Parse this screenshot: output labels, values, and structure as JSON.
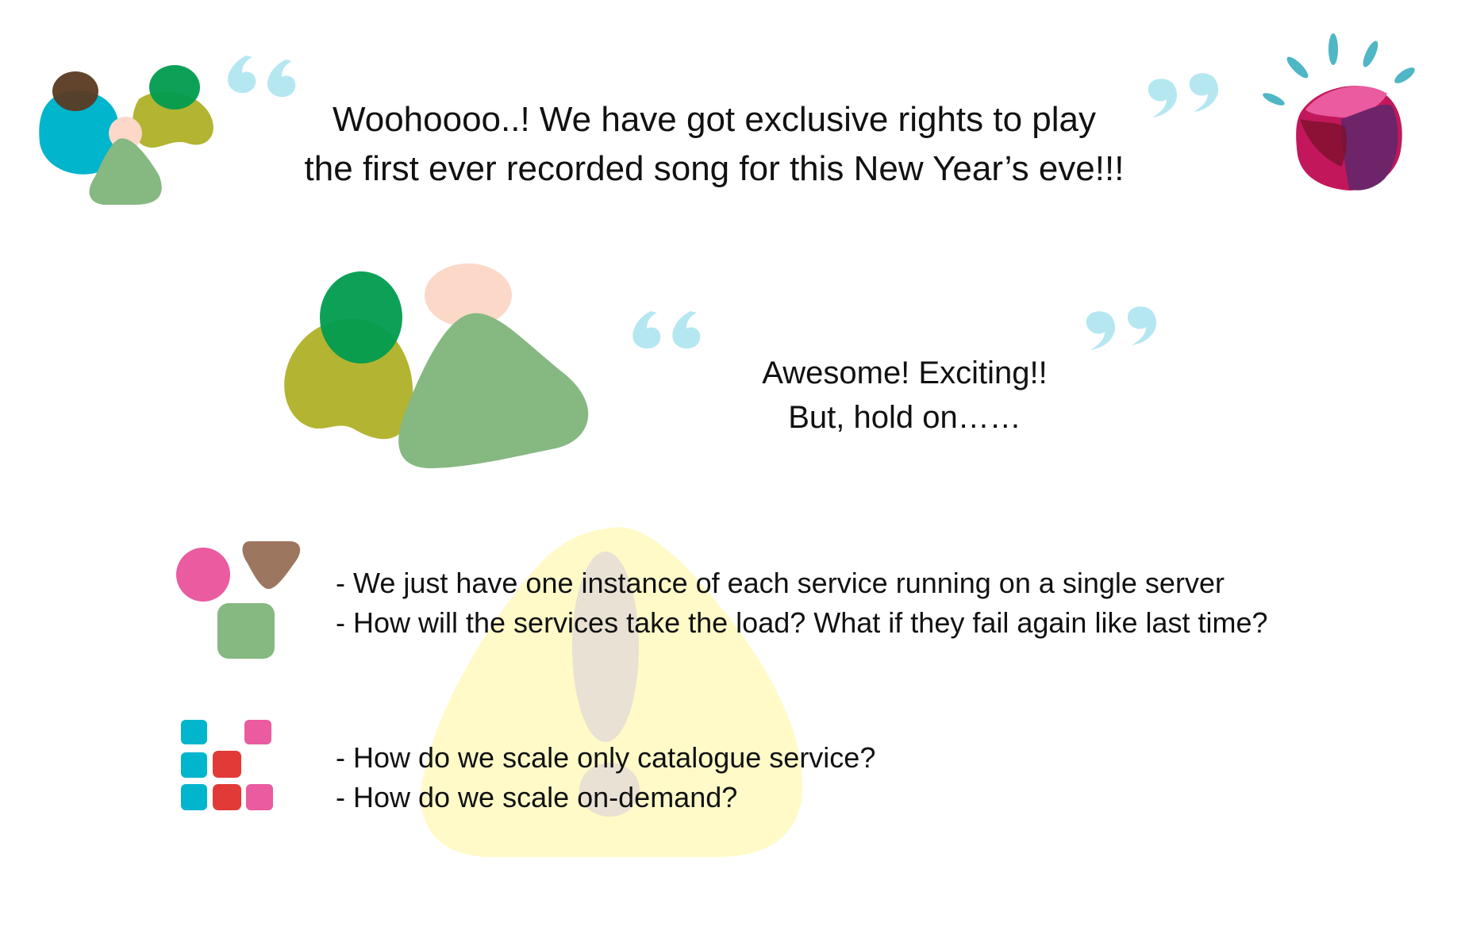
{
  "header": {
    "line1": "Woohoooo..! We have got exclusive rights to play",
    "line2": "the first ever recorded song for this New Year’s eve!!!"
  },
  "reply": {
    "line1": "Awesome! Exciting!!",
    "line2": "But, hold on……"
  },
  "concerns_a": [
    "- We just have one instance of each service running on a single server",
    "- How will the services take the load? What if they fail again like last time?"
  ],
  "concerns_b": [
    "- How do we scale only catalogue service?",
    "- How do we scale on-demand?"
  ],
  "colors": {
    "cyan": "#00b5cc",
    "olive": "#b3b431",
    "green": "#009c4f",
    "sage": "#86b882",
    "peach": "#fbd8c8",
    "pink": "#ea5b9f",
    "brown": "#9d7660",
    "red": "#e23a36",
    "quote": "#a9e3ef",
    "warning": "#fffac8"
  },
  "icons": [
    "team-icon",
    "open-quote-icon",
    "close-quote-icon",
    "gift-box-icon",
    "people-icon",
    "shapes-icon",
    "grid-blocks-icon",
    "warning-icon"
  ]
}
